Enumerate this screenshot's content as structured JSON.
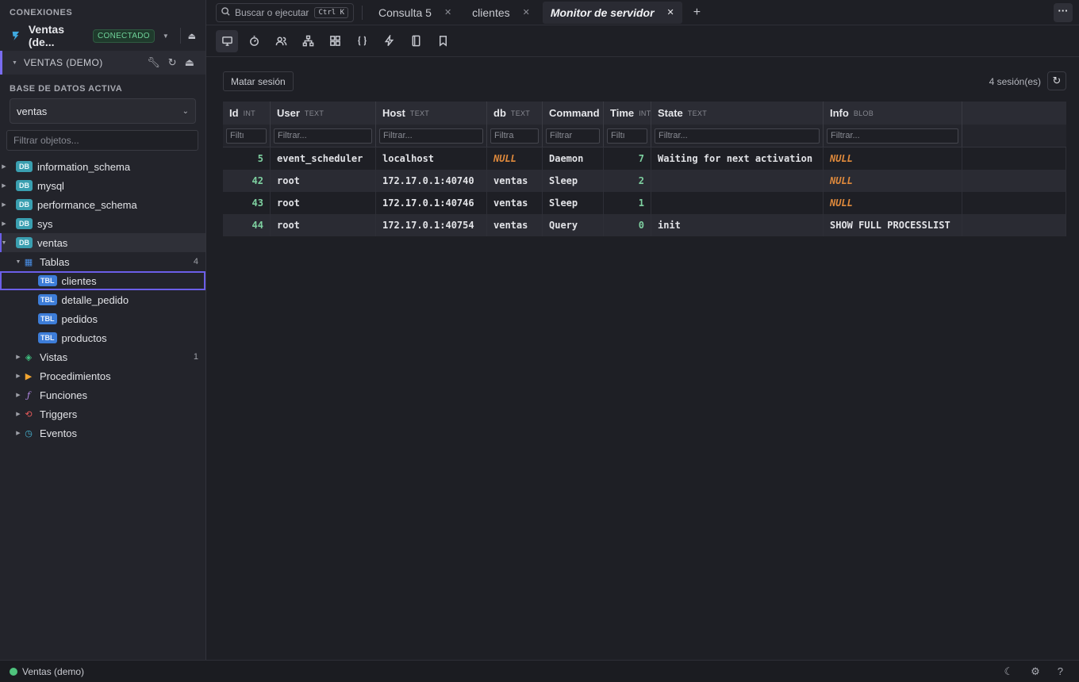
{
  "sidebar": {
    "header": "CONEXIONES",
    "connection": {
      "name": "Ventas (de...",
      "status": "CONECTADO"
    },
    "schema_label": "VENTAS (DEMO)",
    "active_db_label": "BASE DE DATOS ACTIVA",
    "active_db_value": "ventas",
    "filter_placeholder": "Filtrar objetos...",
    "databases": [
      {
        "badge": "DB",
        "name": "information_schema"
      },
      {
        "badge": "DB",
        "name": "mysql"
      },
      {
        "badge": "DB",
        "name": "performance_schema"
      },
      {
        "badge": "DB",
        "name": "sys"
      },
      {
        "badge": "DB",
        "name": "ventas"
      }
    ],
    "tables_group": {
      "label": "Tablas",
      "count": "4"
    },
    "tables": [
      {
        "badge": "TBL",
        "name": "clientes"
      },
      {
        "badge": "TBL",
        "name": "detalle_pedido"
      },
      {
        "badge": "TBL",
        "name": "pedidos"
      },
      {
        "badge": "TBL",
        "name": "productos"
      }
    ],
    "groups": [
      {
        "label": "Vistas",
        "count": "1",
        "icon": "view-icon"
      },
      {
        "label": "Procedimientos",
        "icon": "procedure-icon"
      },
      {
        "label": "Funciones",
        "icon": "function-icon"
      },
      {
        "label": "Triggers",
        "icon": "trigger-icon"
      },
      {
        "label": "Eventos",
        "icon": "event-icon"
      }
    ]
  },
  "topbar": {
    "search_label": "Buscar o ejecutar",
    "search_shortcut": "Ctrl K",
    "tabs": [
      {
        "label": "Consulta 5"
      },
      {
        "label": "clientes"
      },
      {
        "label": "Monitor de servidor"
      }
    ]
  },
  "main": {
    "kill_button": "Matar sesión",
    "session_count": "4 sesión(es)",
    "columns": [
      {
        "name": "Id",
        "type": "INT",
        "filter": "Filtı"
      },
      {
        "name": "User",
        "type": "TEXT",
        "filter": "Filtrar..."
      },
      {
        "name": "Host",
        "type": "TEXT",
        "filter": "Filtrar..."
      },
      {
        "name": "db",
        "type": "TEXT",
        "filter": "Filtra"
      },
      {
        "name": "Command",
        "type": "T",
        "filter": "Filtrar"
      },
      {
        "name": "Time",
        "type": "INT",
        "filter": "Filtı"
      },
      {
        "name": "State",
        "type": "TEXT",
        "filter": "Filtrar..."
      },
      {
        "name": "Info",
        "type": "BLOB",
        "filter": "Filtrar..."
      }
    ],
    "rows": [
      {
        "id": "5",
        "user": "event_scheduler",
        "host": "localhost",
        "db": "NULL",
        "command": "Daemon",
        "time": "7",
        "state": "Waiting for next activation",
        "info": "NULL"
      },
      {
        "id": "42",
        "user": "root",
        "host": "172.17.0.1:40740",
        "db": "ventas",
        "command": "Sleep",
        "time": "2",
        "state": "",
        "info": "NULL"
      },
      {
        "id": "43",
        "user": "root",
        "host": "172.17.0.1:40746",
        "db": "ventas",
        "command": "Sleep",
        "time": "1",
        "state": "",
        "info": "NULL"
      },
      {
        "id": "44",
        "user": "root",
        "host": "172.17.0.1:40754",
        "db": "ventas",
        "command": "Query",
        "time": "0",
        "state": "init",
        "info": "SHOW FULL PROCESSLIST"
      }
    ]
  },
  "statusbar": {
    "connection": "Ventas (demo)"
  },
  "colors": {
    "accent": "#6b5ee8",
    "connected": "#4fc37d",
    "null": "#e08a3c",
    "number": "#7ed0a0"
  }
}
